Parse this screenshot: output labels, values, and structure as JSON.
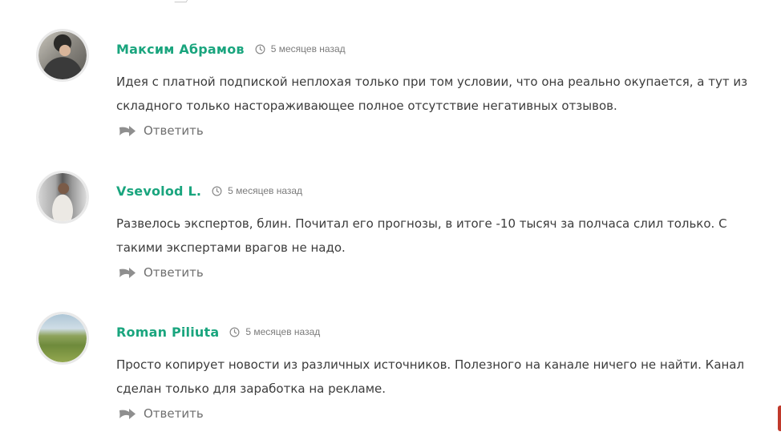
{
  "comments": [
    {
      "author": "Максим Абрамов",
      "time": "5 месяцев назад",
      "text": "Идея с платной подпиской неплохая только при том условии, что она реально окупается, а тут из\nскладного только настораживающее полное отсутствие негативных отзывов.",
      "reply_label": "Ответить"
    },
    {
      "author": "Vsevolod L.",
      "time": "5 месяцев назад",
      "text": "Развелось экспертов, блин. Почитал его прогнозы, в итоге -10 тысяч за полчаса слил только. С\nтакими экспертами врагов не надо.",
      "reply_label": "Ответить"
    },
    {
      "author": "Roman Piliuta",
      "time": "5 месяцев назад",
      "text": "Просто копирует новости из различных источников. Полезного на канале ничего не найти. Канал\nсделан только для заработка на рекламе.",
      "reply_label": "Ответить"
    }
  ],
  "colors": {
    "author": "#1aa57e",
    "text": "#3c3c3c",
    "meta": "#7b7b7b",
    "reply": "#6f6f6f"
  },
  "icons": {
    "time": "clock-icon",
    "reply": "reply-arrow-icon"
  }
}
